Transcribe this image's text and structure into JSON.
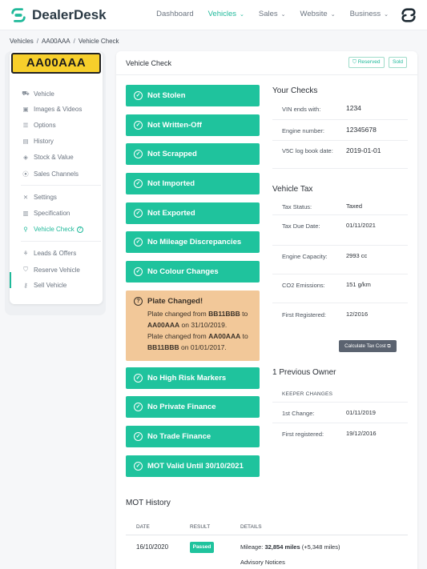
{
  "app": {
    "name": "DealerDesk",
    "accent": "#1fc39d",
    "warning": "#f2c899"
  },
  "nav": {
    "items": [
      {
        "label": "Dashboard",
        "has_dropdown": false,
        "active": false
      },
      {
        "label": "Vehicles",
        "has_dropdown": true,
        "active": true
      },
      {
        "label": "Sales",
        "has_dropdown": true,
        "active": false
      },
      {
        "label": "Website",
        "has_dropdown": true,
        "active": false
      },
      {
        "label": "Business",
        "has_dropdown": true,
        "active": false
      }
    ]
  },
  "breadcrumb": [
    "Vehicles",
    "AA00AAA",
    "Vehicle Check"
  ],
  "sidebar": {
    "plate": "AA00AAA",
    "groups": [
      [
        {
          "label": "Vehicle",
          "icon": "car-icon"
        },
        {
          "label": "Images & Videos",
          "icon": "image-icon"
        },
        {
          "label": "Options",
          "icon": "list-icon"
        },
        {
          "label": "History",
          "icon": "document-icon"
        },
        {
          "label": "Stock & Value",
          "icon": "tag-icon"
        },
        {
          "label": "Sales Channels",
          "icon": "broadcast-icon"
        }
      ],
      [
        {
          "label": "Settings",
          "icon": "tools-icon"
        },
        {
          "label": "Specification",
          "icon": "spec-icon"
        },
        {
          "label": "Vehicle Check",
          "icon": "search-icon",
          "active": true
        }
      ],
      [
        {
          "label": "Leads & Offers",
          "icon": "lead-icon"
        },
        {
          "label": "Reserve Vehicle",
          "icon": "shield-icon"
        },
        {
          "label": "Sell Vehicle",
          "icon": "key-icon"
        }
      ]
    ]
  },
  "main": {
    "title": "Vehicle Check",
    "badges": {
      "reserved": "Reserved",
      "sold": "Sold"
    }
  },
  "checks": [
    "Not Stolen",
    "Not Written-Off",
    "Not Scrapped",
    "Not Imported",
    "Not Exported",
    "No Mileage Discrepancies",
    "No Colour Changes"
  ],
  "plate_warning": {
    "title": "Plate Changed!",
    "line1_prefix": "Plate changed from ",
    "line1_from": "BB11BBB",
    "line1_mid": " to ",
    "line1_to": "AA00AAA",
    "line1_suffix": " on 31/10/2019.",
    "line2_prefix": "Plate changed from ",
    "line2_from": "AA00AAA",
    "line2_mid": " to ",
    "line2_to": "BB11BBB",
    "line2_suffix": " on 01/01/2017."
  },
  "checks_after": [
    "No High Risk Markers",
    "No Private Finance",
    "No Trade Finance",
    "MOT Valid Until 30/10/2021"
  ],
  "your_checks": {
    "title": "Your Checks",
    "rows": [
      {
        "label": "VIN ends with:",
        "value": "1234"
      },
      {
        "label": "Engine number:",
        "value": "12345678"
      },
      {
        "label": "V5C log book date:",
        "value": "2019-01-01"
      }
    ]
  },
  "vehicle_tax": {
    "title": "Vehicle Tax",
    "rows": [
      {
        "label": "Tax Status:",
        "value": "Taxed"
      },
      {
        "label": "Tax Due Date:",
        "value": "01/11/2021"
      },
      {
        "label": "Engine Capacity:",
        "value": "2993 cc"
      },
      {
        "label": "CO2 Emissions:",
        "value": "151 g/km"
      },
      {
        "label": "First Registered:",
        "value": "12/2016"
      }
    ],
    "button": "Calculate Tax Cost"
  },
  "owners": {
    "title": "1 Previous Owner",
    "header": "KEEPER CHANGES",
    "rows": [
      {
        "label": "1st Change:",
        "value": "01/11/2019"
      },
      {
        "label": "First registered:",
        "value": "19/12/2016"
      }
    ]
  },
  "mot": {
    "title": "MOT History",
    "columns": [
      "DATE",
      "RESULT",
      "DETAILS"
    ],
    "rows": [
      {
        "date": "16/10/2020",
        "result": "Passed",
        "mileage_label": "Mileage: ",
        "mileage": "32,854 miles",
        "delta": " (+5,348 miles)",
        "notes": "Advisory Notices"
      }
    ]
  }
}
